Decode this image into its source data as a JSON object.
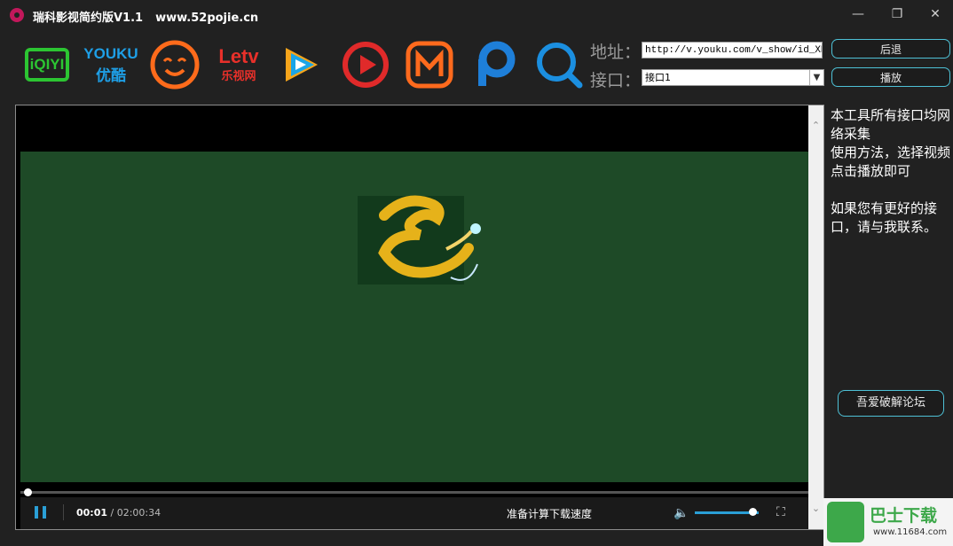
{
  "window": {
    "title": "瑞科影视简约版V1.1",
    "site": "www.52pojie.cn"
  },
  "logos": [
    {
      "name": "iqiyi",
      "text": "iQIYI",
      "color": "#2cc532"
    },
    {
      "name": "youku",
      "text": "YOUKU",
      "sub": "优酷",
      "color": "#1e9fe6"
    },
    {
      "name": "tudou",
      "color": "#ff6b1b"
    },
    {
      "name": "letv",
      "text": "Letv",
      "sub": "乐视网",
      "color": "#e8302a"
    },
    {
      "name": "tencent",
      "color": "#1aa5e8"
    },
    {
      "name": "mgtv-red",
      "color": "#e02a2a"
    },
    {
      "name": "mgtv",
      "color": "#ff6a1d"
    },
    {
      "name": "pptv",
      "color": "#1e7fd9"
    },
    {
      "name": "sohu",
      "color": "#1b8fe0"
    }
  ],
  "form": {
    "address_label": "地址：",
    "address_value": "http://v.youku.com/v_show/id_XMTc",
    "interface_label": "接口：",
    "interface_value": "接口1"
  },
  "buttons": {
    "back": "后退",
    "play": "播放",
    "forum": "吾爱破解论坛"
  },
  "player": {
    "current_time": "00:01",
    "total_time": "02:00:34",
    "status": "准备计算下载速度",
    "progress": 0.005,
    "volume": 0.9
  },
  "info": {
    "line1": "本工具所有接口均网络采集",
    "line2": "使用方法，选择视频点击播放即可",
    "line3": "如果您有更好的接口，请与我联系。"
  },
  "watermark": {
    "text": "巴士下载",
    "url": "www.11684.com"
  }
}
